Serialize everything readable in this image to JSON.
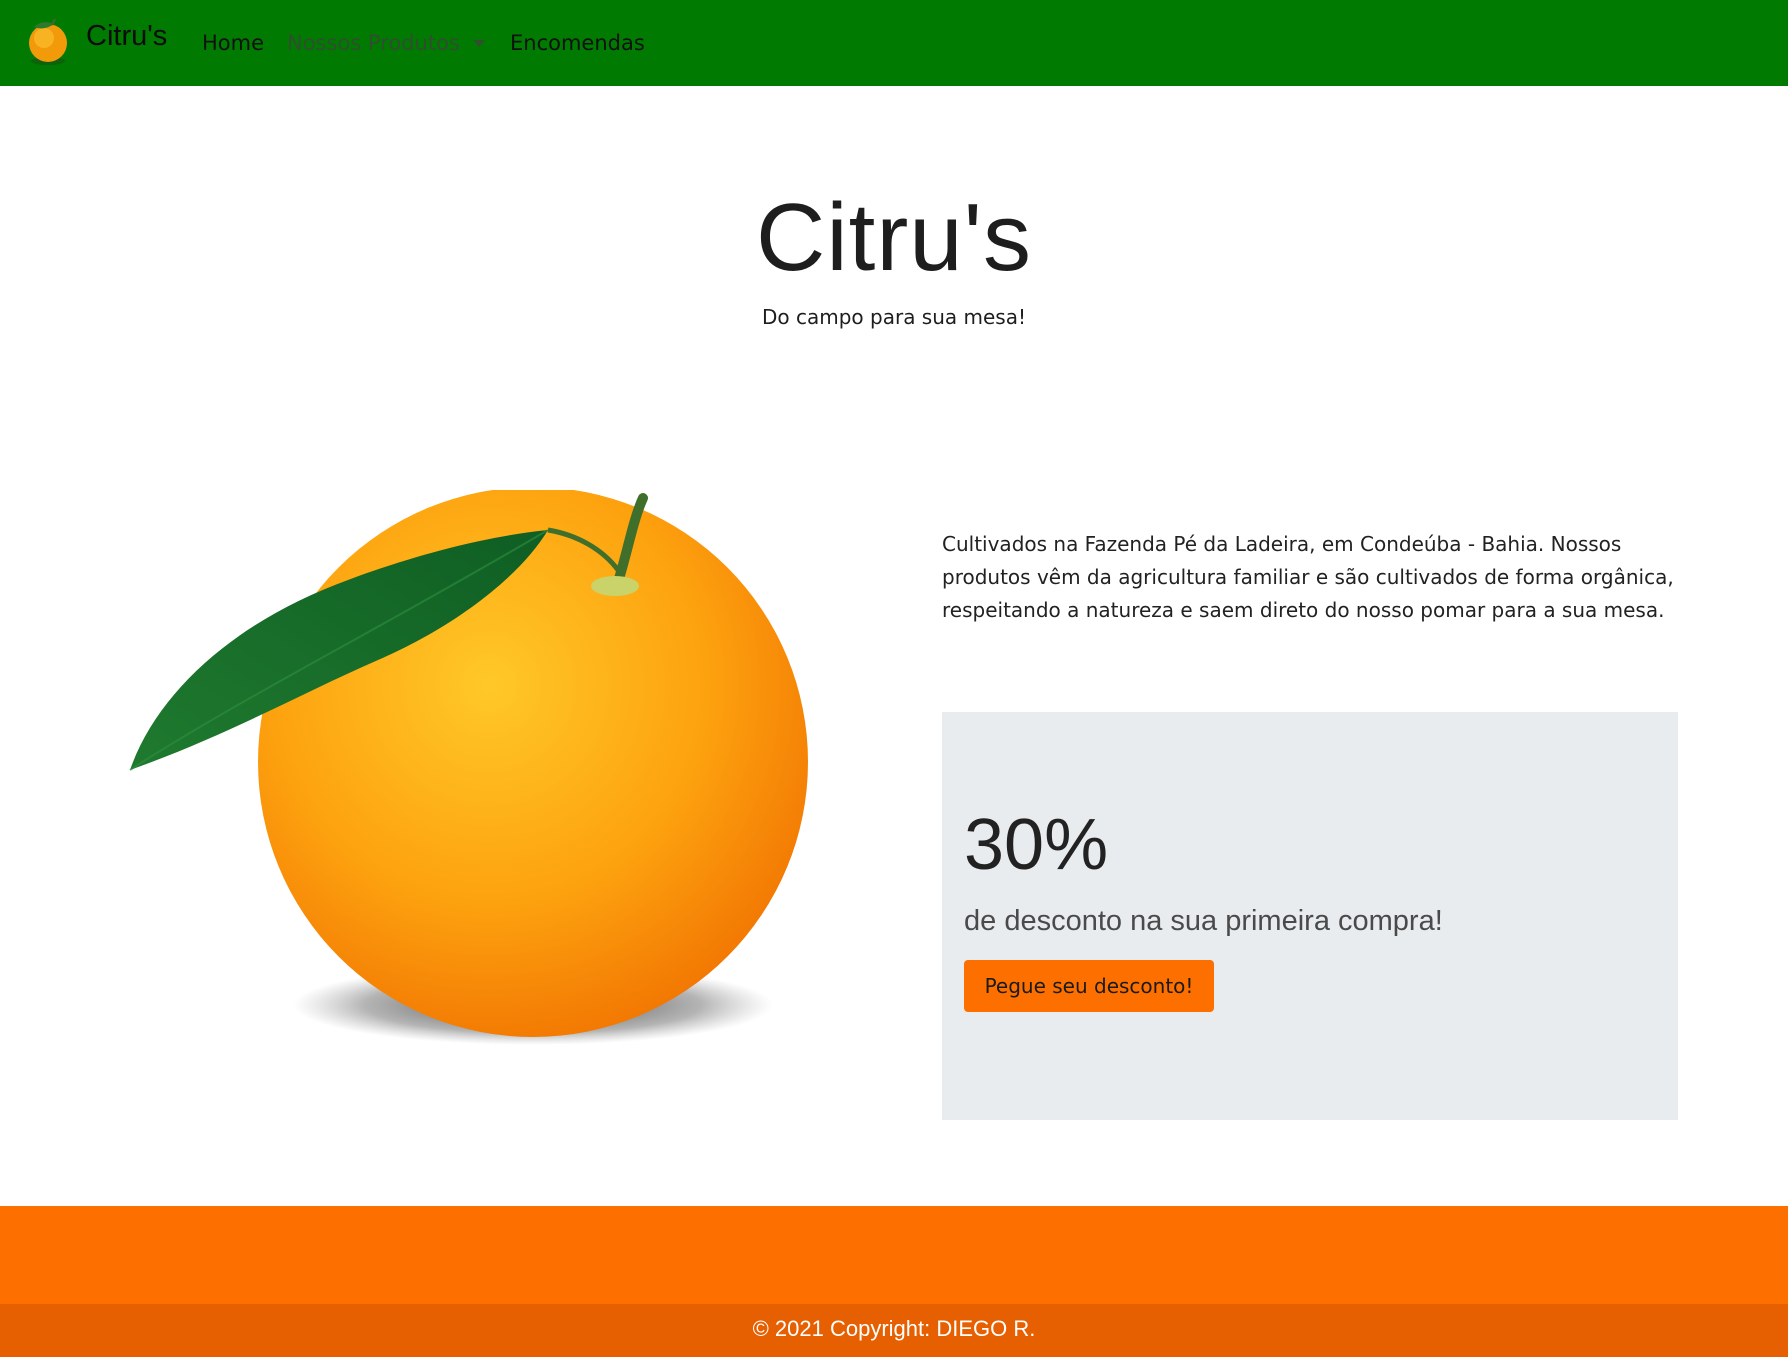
{
  "navbar": {
    "brand": "Citru's",
    "brand_icon": "orange-logo-icon",
    "items": [
      {
        "label": "Home"
      },
      {
        "label": "Nossos Produtos",
        "dropdown": true
      },
      {
        "label": "Encomendas"
      }
    ]
  },
  "hero": {
    "title": "Citru's",
    "subtitle": "Do campo para sua mesa!"
  },
  "about": {
    "image": "orange-with-leaf-photo",
    "text": "Cultivados na Fazenda Pé da Ladeira, em Condeúba - Bahia. Nossos produtos vêm da agricultura familiar e são cultivados de forma orgânica, respeitando a natureza e saem direto do nosso pomar para a sua mesa."
  },
  "promo": {
    "headline": "30%",
    "subtext": "de desconto na sua primeira compra!",
    "button_label": "Pegue seu desconto!"
  },
  "footer": {
    "copyright": "© 2021 Copyright: DIEGO R."
  },
  "colors": {
    "navbar": "#007a00",
    "accent": "#fd7000",
    "footer_dark": "#e65f00",
    "promo_bg": "#e9ecef"
  }
}
